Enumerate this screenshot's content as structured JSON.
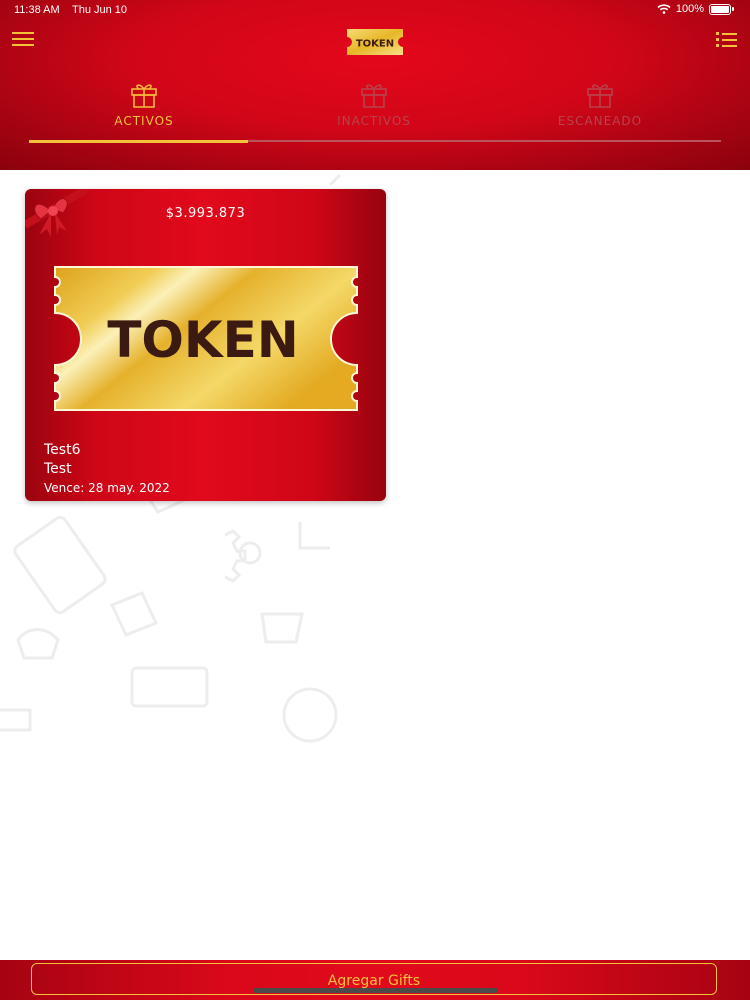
{
  "status_bar": {
    "time": "11:38 AM",
    "date": "Thu Jun 10",
    "battery": "100%",
    "wifi_icon": "wifi-icon",
    "battery_icon": "battery-icon"
  },
  "header": {
    "menu_icon": "hamburger-menu-icon",
    "logo_text": "TOKEN",
    "list_icon": "list-menu-icon"
  },
  "tabs": [
    {
      "label": "ACTIVOS",
      "icon": "gift-icon",
      "active": true
    },
    {
      "label": "INACTIVOS",
      "icon": "gift-icon",
      "active": false
    },
    {
      "label": "ESCANEADO",
      "icon": "gift-icon",
      "active": false
    }
  ],
  "cards": [
    {
      "amount": "$3.993.873",
      "ticket_text": "TOKEN",
      "name": "Test6",
      "subtitle": "Test",
      "expiry": "Vence: 28 may. 2022"
    }
  ],
  "footer": {
    "add_button_label": "Agregar Gifts"
  },
  "colors": {
    "primary_red": "#e00a1c",
    "dark_red": "#8a020d",
    "accent_gold": "#f4c23a",
    "inactive_tab": "#b8434c"
  }
}
